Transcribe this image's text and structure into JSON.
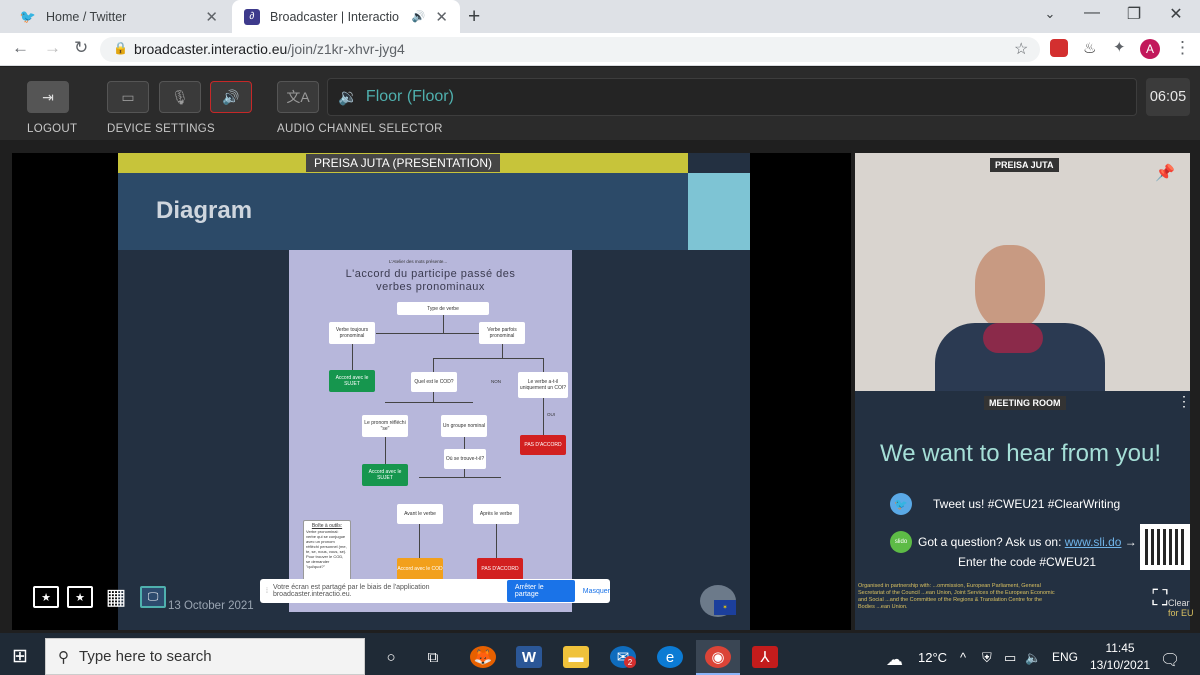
{
  "browser": {
    "tabs": [
      {
        "title": "Home / Twitter"
      },
      {
        "title": "Broadcaster | Interactio"
      }
    ],
    "url_host": "broadcaster.interactio.eu",
    "url_path": "/join/z1kr-xhvr-jyg4",
    "profile_initial": "A"
  },
  "toolbar": {
    "logout": "LOGOUT",
    "device_settings": "DEVICE SETTINGS",
    "audio_channel_selector": "AUDIO CHANNEL SELECTOR",
    "channel": "Floor (Floor)",
    "timer": "06:05"
  },
  "slide": {
    "presenter_label": "PREISA JUTA (PRESENTATION)",
    "title": "Diagram",
    "date": "13 October 2021",
    "document": {
      "subtitle": "L'Atelier des mots présente...",
      "title_line1": "L'accord du participe passé des",
      "title_line2": "verbes pronominaux",
      "type": "Type de verbe",
      "toujours": "Verbe toujours pronominal",
      "parfois": "Verbe parfois pronominal",
      "accord_sujet": "Accord avec le SUJET",
      "quel_cod": "Quel est le COD?",
      "non": "NON",
      "oui": "OUI",
      "le_verbe": "Le verbe a-t-il uniquement un COI?",
      "pronom": "Le pronom réfléchi \"se\"",
      "groupe": "Un groupe nominal",
      "pas_accord": "PAS D'ACCORD",
      "ou": "Où se trouve-t-il?",
      "accord_sujet2": "Accord avec le SUJET",
      "avant": "Avant le verbe",
      "apres": "Après le verbe",
      "boite_title": "Boîte à outils:",
      "boite_text": "Verbe pronominal: verbe qui se conjugue avec un pronom réfléchi personnel (me, te, se, nous, vous, se). Pour trouver le COD, se demander \"qui/quoi?\"",
      "accord_cod": "Accord avec le COD",
      "pas_accord2": "PAS D'ACCORD"
    },
    "share_notice": "Votre écran est partagé par le biais de l'application broadcaster.interactio.eu.",
    "share_stop": "Arrêter le partage",
    "share_hide": "Masquer"
  },
  "side": {
    "speaker": "PREISA JUTA",
    "room": "MEETING ROOM",
    "headline": "We want to hear from you!",
    "tweet": "Tweet us! #CWEU21 #ClearWriting",
    "question_prefix": "Got a question? Ask us on: ",
    "question_link": "www.sli.do",
    "question_arrow": "→",
    "code": "Enter the code #CWEU21",
    "slido": "slido",
    "clear": "Clear",
    "clear2": "for EU",
    "partner": "Organised in partnership with: ...ommission, European Parliament, General Secretariat of the Council ...ean Union, Joint Services of the European Economic and Social ...and the Committee of the Regions & Translation Centre for the Bodies ...ean Union."
  },
  "taskbar": {
    "search_placeholder": "Type here to search",
    "weather": "12°C",
    "lang": "ENG",
    "time": "11:45",
    "date": "13/10/2021",
    "notif_count": "2"
  },
  "colors": {
    "accent": "#4fb0ae",
    "slide_bg": "#233041",
    "presenter_bar": "#c7c43a"
  }
}
